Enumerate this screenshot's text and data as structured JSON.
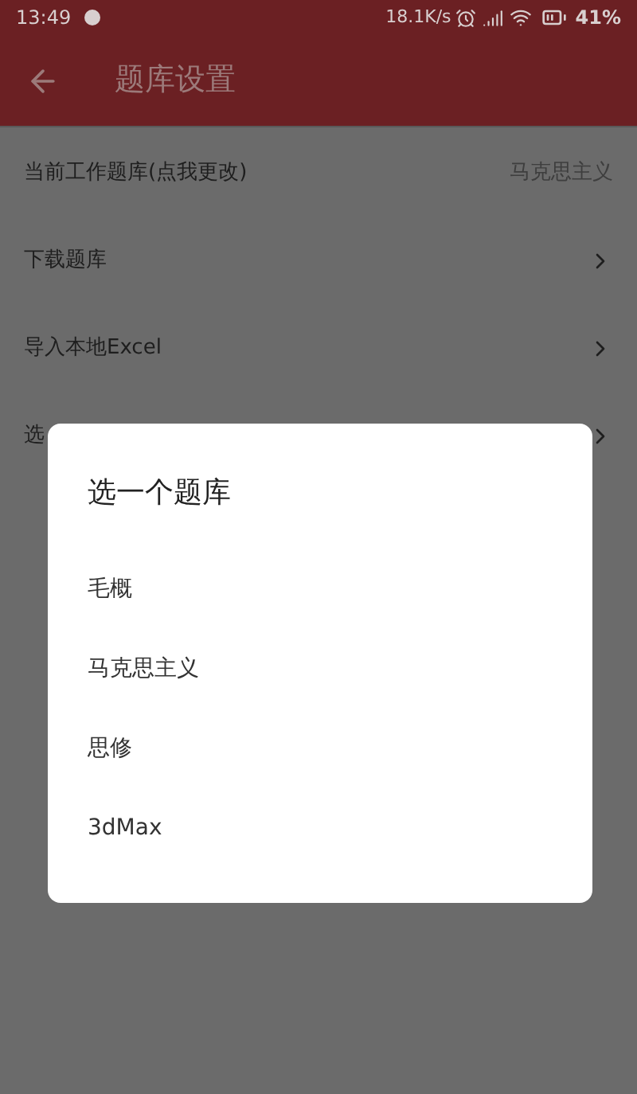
{
  "status_bar": {
    "time": "13:49",
    "net_speed": "18.1K/s",
    "battery": "41%"
  },
  "app_bar": {
    "title": "题库设置"
  },
  "settings": [
    {
      "kind": "value",
      "label": "当前工作题库(点我更改)",
      "value": "马克思主义"
    },
    {
      "kind": "link",
      "label": "下载题库"
    },
    {
      "kind": "link",
      "label": "导入本地Excel"
    },
    {
      "kind": "link",
      "label": "选"
    }
  ],
  "dialog": {
    "title": "选一个题库",
    "options": [
      "毛概",
      "马克思主义",
      "思修",
      "3dMax"
    ]
  }
}
